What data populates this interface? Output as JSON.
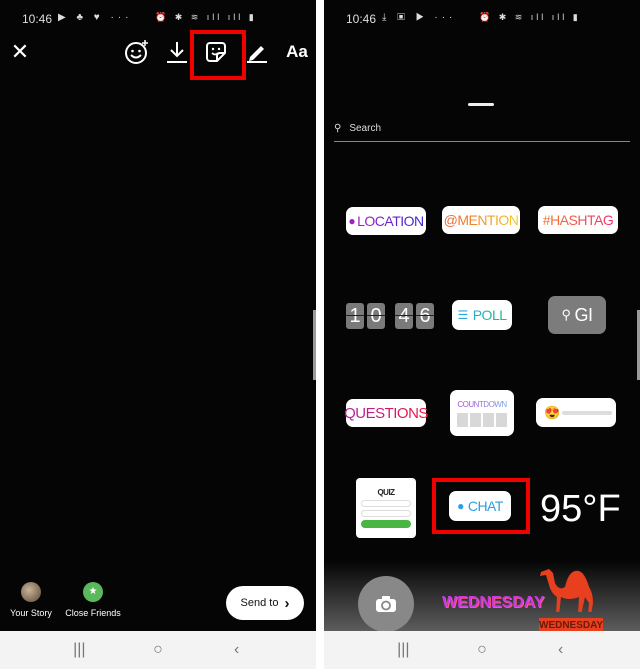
{
  "left": {
    "status": {
      "time": "10:46",
      "left_icons": "▶ ♣ ♥ ···",
      "right_icons": "⏰ ✱ ≋ ıll ıll ▮"
    },
    "toolbar": {
      "close": "✕",
      "effects": "face-effects",
      "download": "download",
      "sticker": "sticker",
      "draw": "pen",
      "text_label": "Aa"
    },
    "story_options": [
      {
        "label": "Your Story"
      },
      {
        "label": "Close Friends"
      }
    ],
    "send_label": "Send to",
    "send_chevron": "›"
  },
  "right": {
    "status": {
      "time": "10:46",
      "left_icons": "⤓ ▣ ▶ ···",
      "right_icons": "⏰ ✱ ≋ ıll ıll ▮"
    },
    "search_placeholder": "Search",
    "stickers": {
      "location": "LOCATION",
      "mention": "@MENTION",
      "hashtag": "#HASHTAG",
      "clock_digits": [
        "1",
        "0",
        "4",
        "6"
      ],
      "poll": "POLL",
      "gif": "GI",
      "questions": "QUESTIONS",
      "countdown": "COUNTDOWN",
      "emoji_slider": "😍",
      "quiz": "QUIZ",
      "chat": "CHAT",
      "temperature": "95°F",
      "day_text": "WEDNESDAY",
      "camel_day": "WEDNESDAY"
    }
  },
  "navbar": {
    "recents": "|||",
    "home": "○",
    "back": "‹"
  },
  "colors": {
    "highlight": "#f10000",
    "close_friends": "#5cb85c",
    "chat_blue": "#2a9ee8"
  }
}
